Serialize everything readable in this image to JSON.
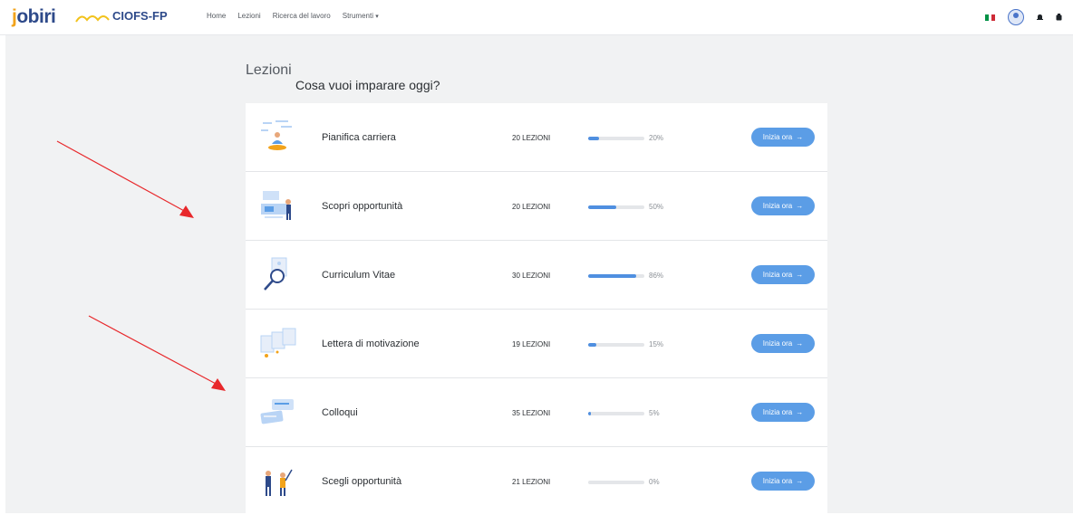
{
  "header": {
    "logo_text_rest": "obiri",
    "logo_text_j": "j",
    "partner_logo": "CIOFS-FP",
    "nav": [
      "Home",
      "Lezioni",
      "Ricerca del lavoro",
      "Strumenti"
    ],
    "dropdown_caret": "▾",
    "flag_colors": [
      "#009246",
      "#ffffff",
      "#ce2b37"
    ],
    "icons": [
      "italian-flag-icon",
      "user-avatar-icon",
      "notification-bell-icon",
      "settings-icon"
    ]
  },
  "main": {
    "title": "Lezioni",
    "subtitle": "Cosa vuoi imparare oggi?"
  },
  "lessons": [
    {
      "title": "Pianifica carriera",
      "count": "20 LEZIONI",
      "progress": 0.2,
      "pct": "20%",
      "button": "Inizia ora"
    },
    {
      "title": "Scopri opportunità",
      "count": "20 LEZIONI",
      "progress": 0.5,
      "pct": "50%",
      "button": "Inizia ora"
    },
    {
      "title": "Curriculum Vitae",
      "count": "30 LEZIONI",
      "progress": 0.86,
      "pct": "86%",
      "button": "Inizia ora"
    },
    {
      "title": "Lettera di motivazione",
      "count": "19 LEZIONI",
      "progress": 0.15,
      "pct": "15%",
      "button": "Inizia ora"
    },
    {
      "title": "Colloqui",
      "count": "35 LEZIONI",
      "progress": 0.05,
      "pct": "5%",
      "button": "Inizia ora"
    },
    {
      "title": "Scegli opportunità",
      "count": "21 LEZIONI",
      "progress": 0.0,
      "pct": "0%",
      "button": "Inizia ora"
    }
  ],
  "button_arrow": "→",
  "colors": {
    "accent": "#5b9de6",
    "progress_fill": "#4f8fe0",
    "annotation_arrow": "#e8282b",
    "background": "#f1f2f3"
  }
}
